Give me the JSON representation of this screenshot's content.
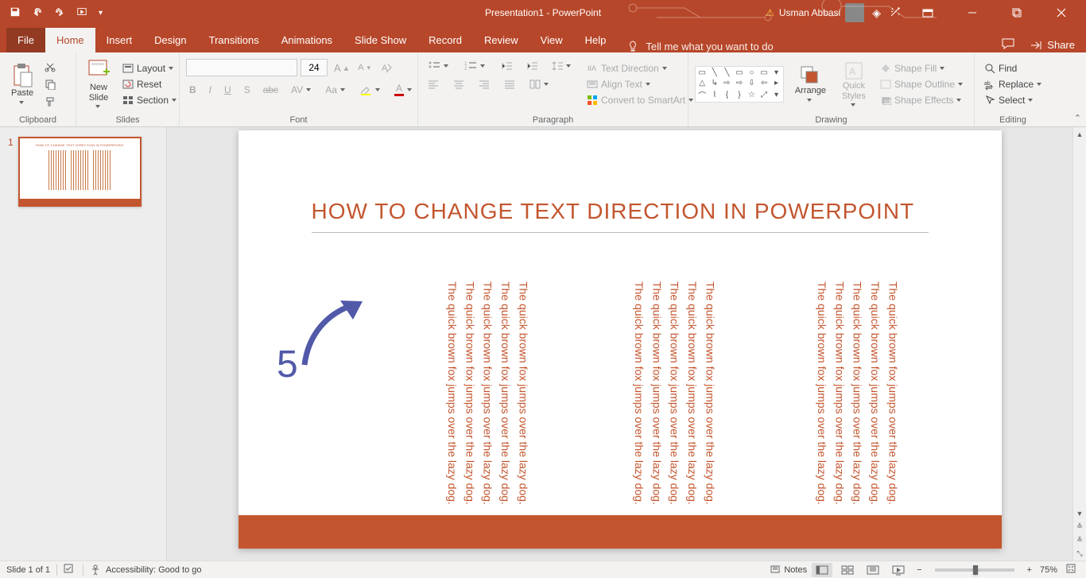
{
  "title_bar": {
    "doc_title": "Presentation1 - PowerPoint",
    "user_name": "Usman Abbasi"
  },
  "tabs": {
    "file": "File",
    "home": "Home",
    "insert": "Insert",
    "design": "Design",
    "transitions": "Transitions",
    "animations": "Animations",
    "slide_show": "Slide Show",
    "record": "Record",
    "review": "Review",
    "view": "View",
    "help": "Help",
    "tell_me": "Tell me what you want to do",
    "share": "Share"
  },
  "ribbon": {
    "clipboard": {
      "paste": "Paste",
      "label": "Clipboard"
    },
    "slides": {
      "new_slide": "New\nSlide",
      "layout": "Layout",
      "reset": "Reset",
      "section": "Section",
      "label": "Slides"
    },
    "font": {
      "name": "",
      "size": "24",
      "label": "Font"
    },
    "paragraph": {
      "text_direction": "Text Direction",
      "align_text": "Align Text",
      "convert_smartart": "Convert to SmartArt",
      "label": "Paragraph"
    },
    "drawing": {
      "arrange": "Arrange",
      "quick_styles": "Quick\nStyles",
      "shape_fill": "Shape Fill",
      "shape_outline": "Shape Outline",
      "shape_effects": "Shape Effects",
      "label": "Drawing"
    },
    "editing": {
      "find": "Find",
      "replace": "Replace",
      "select": "Select",
      "label": "Editing"
    }
  },
  "thumbnail": {
    "number": "1",
    "mini_title": "HOW TO CHANGE TEXT DIRECTION IN POWERPOINT"
  },
  "slide": {
    "title": "HOW TO  CHANGE  TEXT DIRECTION IN POWERPOINT",
    "annotation_number": "5",
    "body_sentence": "The quick brown fox jumps over the lazy dog.",
    "body_repeat": 5
  },
  "status": {
    "slide_info": "Slide 1 of 1",
    "accessibility": "Accessibility: Good to go",
    "notes": "Notes",
    "zoom_pct": "75%"
  }
}
